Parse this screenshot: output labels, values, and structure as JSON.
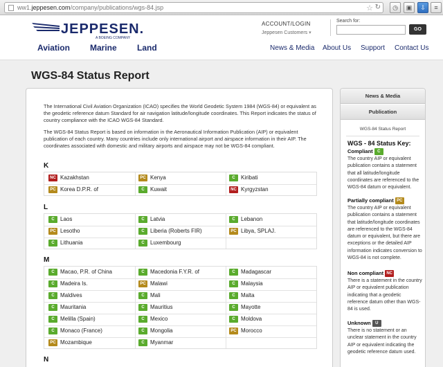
{
  "browser": {
    "url_prefix": "ww1.",
    "url_domain": "jeppesen.com",
    "url_path": "/company/publications/wgs-84.jsp"
  },
  "header": {
    "logo": "JEPPESEN.",
    "logo_sub": "A BOEING COMPANY",
    "account_title": "ACCOUNT/LOGIN",
    "account_sub": "Jeppesen Customers",
    "search_label": "Search for:",
    "go_label": "GO"
  },
  "nav": {
    "left": [
      "Aviation",
      "Marine",
      "Land"
    ],
    "right": [
      "News & Media",
      "About Us",
      "Support",
      "Contact Us"
    ]
  },
  "page": {
    "title": "WGS-84 Status Report",
    "intro1": "The International Civil Aviation Organization (ICAO) specifies the World Geodetic System 1984 (WGS-84) or equivalent as the geodetic reference datum Standard for air navigation latitude/longitude coordinates. This Report indicates the status of country compliance with the ICAO WGS-84 Standard.",
    "intro2": "The WGS-84 Status Report is based on information in the Aeronautical Information Publication (AIP) or equivalent publication of each country. Many countries include only international airport and airspace information in their AIP. The coordinates associated with domestic and military airports and airspace may not be WGS-84 compliant."
  },
  "sections": [
    {
      "letter": "K",
      "rows": [
        [
          {
            "s": "NC",
            "n": "Kazakhstan"
          },
          {
            "s": "PC",
            "n": "Kenya"
          },
          {
            "s": "C",
            "n": "Kiribati"
          }
        ],
        [
          {
            "s": "PC",
            "n": "Korea D.P.R. of"
          },
          {
            "s": "C",
            "n": "Kuwait"
          },
          {
            "s": "NC",
            "n": "Kyrgyzstan"
          }
        ]
      ]
    },
    {
      "letter": "L",
      "rows": [
        [
          {
            "s": "C",
            "n": "Laos"
          },
          {
            "s": "C",
            "n": "Latvia"
          },
          {
            "s": "C",
            "n": "Lebanon"
          }
        ],
        [
          {
            "s": "PC",
            "n": "Lesotho"
          },
          {
            "s": "C",
            "n": "Liberia (Roberts FIR)"
          },
          {
            "s": "PC",
            "n": "Libya, SPLAJ."
          }
        ],
        [
          {
            "s": "C",
            "n": "Lithuania"
          },
          {
            "s": "C",
            "n": "Luxembourg"
          },
          null
        ]
      ]
    },
    {
      "letter": "M",
      "rows": [
        [
          {
            "s": "C",
            "n": "Macao, P.R. of China"
          },
          {
            "s": "C",
            "n": "Macedonia F.Y.R. of"
          },
          {
            "s": "C",
            "n": "Madagascar"
          }
        ],
        [
          {
            "s": "C",
            "n": "Madeira Is."
          },
          {
            "s": "PC",
            "n": "Malawi"
          },
          {
            "s": "C",
            "n": "Malaysia"
          }
        ],
        [
          {
            "s": "C",
            "n": "Maldives"
          },
          {
            "s": "C",
            "n": "Mali"
          },
          {
            "s": "C",
            "n": "Malta"
          }
        ],
        [
          {
            "s": "C",
            "n": "Mauritania"
          },
          {
            "s": "C",
            "n": "Mauritius"
          },
          {
            "s": "C",
            "n": "Mayotte"
          }
        ],
        [
          {
            "s": "C",
            "n": "Melilla (Spain)"
          },
          {
            "s": "C",
            "n": "Mexico"
          },
          {
            "s": "C",
            "n": "Moldova"
          }
        ],
        [
          {
            "s": "C",
            "n": "Monaco (France)"
          },
          {
            "s": "C",
            "n": "Mongolia"
          },
          {
            "s": "PC",
            "n": "Morocco"
          }
        ],
        [
          {
            "s": "PC",
            "n": "Mozambique"
          },
          {
            "s": "C",
            "n": "Myanmar"
          },
          null
        ]
      ]
    },
    {
      "letter": "N",
      "rows": []
    }
  ],
  "sidebar": {
    "tab1": "News & Media",
    "tab2": "Publication",
    "crumb": "WGS-84 Status Report",
    "key_title": "WGS - 84 Status Key:",
    "compliant_label": "Compliant",
    "compliant_badge": "C",
    "compliant_text": "The country AIP or equivalent publication contains a statement that all latitude/longitude coordinates are referenced to the WGS-84 datum or equivalent.",
    "partial_label": "Partially compliant",
    "partial_badge": "PC",
    "partial_text": "The country AIP or equivalent publication contains a statement that latitude/longitude coordinates are referenced to the WGS-84 datum or equivalent, but there are exceptions or the detailed AIP information indicates conversion to WGS-84 is not complete.",
    "non_label": "Non compliant",
    "non_badge": "NC",
    "non_text": "There is a statement in the country AIP or equivalent publication indicating that a geodetic reference datum other than WGS-84 is used.",
    "unknown_label": "Unknown",
    "unknown_badge": "U",
    "unknown_text": "There is no statement or an unclear statement in the country AIP or equivalent indicating the geodetic reference datum used."
  }
}
